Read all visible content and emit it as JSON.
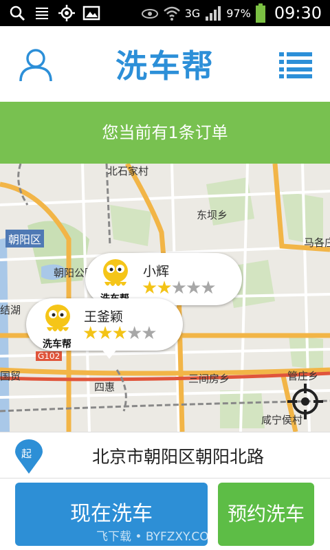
{
  "status_bar": {
    "signal_text": "3G",
    "battery": "97%",
    "time": "09:30",
    "icons": [
      "search-icon",
      "menu-lines-icon",
      "gps-icon",
      "image-icon",
      "eye-icon",
      "wifi-icon",
      "signal-icon",
      "battery-icon"
    ]
  },
  "header": {
    "logo": "洗车帮",
    "user_icon": "user-icon",
    "menu_icon": "list-icon",
    "accent": "#2c8fd8"
  },
  "banner": {
    "text": "您当前有1条订单",
    "color": "#78c150"
  },
  "map": {
    "labels": {
      "beishidian": "北石家村",
      "dongbaxiang": "东坝乡",
      "chaoyangqu": "朝阳区",
      "majiapu": "马各庄",
      "chaoyanggongyuan": "朝阳公园",
      "jiehu": "结湖",
      "guomao": "国贸",
      "sihui": "四惠",
      "sanjianfang": "三间房乡",
      "guanzhuang": "管庄乡",
      "xianning": "咸宁侯村",
      "g102": "G102"
    },
    "drivers": [
      {
        "name": "小辉",
        "rating": 2,
        "max": 5,
        "logo": "洗车帮"
      },
      {
        "name": "王釜颖",
        "rating": 3,
        "max": 5,
        "logo": "洗车帮"
      }
    ]
  },
  "address": {
    "pin_label": "起",
    "text": "北京市朝阳区朝阳北路"
  },
  "actions": {
    "now": "现在洗车",
    "book": "预约洗车",
    "now_color": "#2d8fd6",
    "book_color": "#5dbd46"
  },
  "watermark": "飞下载 • BYFZXY.COM"
}
